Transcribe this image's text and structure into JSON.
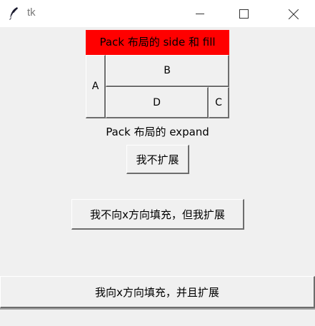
{
  "window": {
    "title": "tk",
    "app_icon": "feather-icon",
    "controls": [
      "minimize-icon",
      "maximize-icon",
      "close-icon"
    ]
  },
  "pack_demo": {
    "side_fill_label": "Pack 布局的 side 和 fill",
    "label_bg": "#ff0000",
    "buttons": {
      "a": "A",
      "b": "B",
      "c": "C",
      "d": "D"
    }
  },
  "expand_demo": {
    "label": "Pack 布局的 expand",
    "no_expand": "我不扩展",
    "expand_no_fill": "我不向x方向填充，但我扩展",
    "fill_and_expand": "我向x方向填充，并且扩展"
  }
}
